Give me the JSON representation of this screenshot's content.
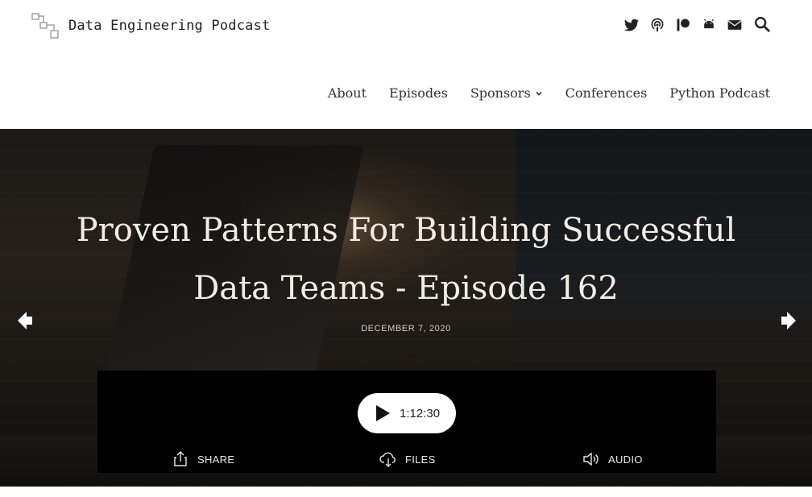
{
  "site": {
    "title": "Data Engineering Podcast"
  },
  "social_icons": [
    "twitter-icon",
    "podcast-icon",
    "patreon-icon",
    "android-icon",
    "email-icon"
  ],
  "nav": {
    "items": [
      {
        "label": "About"
      },
      {
        "label": "Episodes"
      },
      {
        "label": "Sponsors"
      },
      {
        "label": "Conferences"
      },
      {
        "label": "Python Podcast"
      }
    ]
  },
  "episode": {
    "title": "Proven Patterns For Building Successful Data Teams - Episode 162",
    "date": "DECEMBER 7, 2020"
  },
  "player": {
    "duration": "1:12:30",
    "share_label": "SHARE",
    "files_label": "FILES",
    "audio_label": "AUDIO"
  },
  "colors": {
    "header_bg": "#ffffff",
    "player_bg": "#000000",
    "title_text": "#f3ece4"
  }
}
